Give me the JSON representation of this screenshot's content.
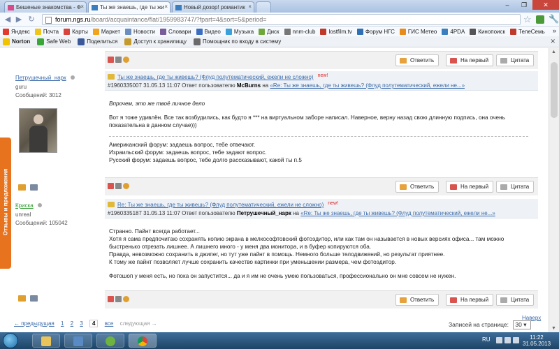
{
  "browser": {
    "tabs": [
      {
        "title": "Бешеные знакомства - Ф"
      },
      {
        "title": "Ты же знаешь, где ты жи"
      },
      {
        "title": "Новый дозор! романтик"
      }
    ],
    "url_host": "forum.ngs.ru",
    "url_path": "/board/acquaintance/flat/1959983747/?fpart=4&sort=5&period=",
    "bookmarks": [
      {
        "label": "Яндекс",
        "color": "#e23b2e"
      },
      {
        "label": "Почта",
        "color": "#f0c419"
      },
      {
        "label": "Карты",
        "color": "#d8433b"
      },
      {
        "label": "Маркет",
        "color": "#f3a21d"
      },
      {
        "label": "Новости",
        "color": "#6c8ebf"
      },
      {
        "label": "Словари",
        "color": "#7a5c9a"
      },
      {
        "label": "Видео",
        "color": "#3b6dc1"
      },
      {
        "label": "Музыка",
        "color": "#3aa0d9"
      },
      {
        "label": "Диск",
        "color": "#6fa83a"
      },
      {
        "label": "nnm-club",
        "color": "#777777"
      },
      {
        "label": "lostfilm.tv",
        "color": "#c0392b"
      },
      {
        "label": "Форум НГС",
        "color": "#2f6fb3"
      },
      {
        "label": "ГИС Метео",
        "color": "#e88b1a"
      },
      {
        "label": "4PDA",
        "color": "#3a7ebf"
      },
      {
        "label": "Кинопоиск",
        "color": "#555555"
      },
      {
        "label": "ТелеСемь",
        "color": "#c0392b"
      }
    ],
    "norton_items": [
      {
        "label": "Norton",
        "color": "#f2c200"
      },
      {
        "label": "Safe Web",
        "color": "#3aa63a"
      },
      {
        "label": "Поделиться",
        "color": "#3b5998"
      },
      {
        "label": "Доступ к хранилищу",
        "color": "#c49a2c"
      },
      {
        "label": "Помощник по входу в систему",
        "color": "#6b6b6b"
      }
    ]
  },
  "feedback_tab": "Отзывы и предложения",
  "actions": {
    "reply": "Ответить",
    "first": "На первый",
    "quote": "Цитата"
  },
  "posts": [
    {
      "author": "Петрушечный_нарк",
      "role": "guru",
      "count_label": "Сообщений: 3012",
      "title": "Ты же знаешь, где ты живешь? (Флуд полутематический, ежели не сложно)",
      "new_badge": "new!",
      "meta_prefix": "#1960335007 31.05.13 11:07  Ответ пользователю",
      "reply_to": "McBurns",
      "meta_on": "на",
      "reply_link": "«Re: Ты же знаешь, где ты живешь? (Флуд полутематический, ежели не...»",
      "body": [
        "Впрочем, это же твоё личное дело",
        "Вот я тоже удивлён. Все так возбудились, как будто я *** на виртуальном заборе написал. Наверное, верну назад свою длинную подпись, она очень показательна в данном случае)))",
        "Американский форум: задаешь вопрос, тебе отвечают.",
        "Израильский форум: задаешь вопрос, тебе задают вопрос.",
        "Русский форум: задаешь вопрос, тебе долго рассказывают, какой ты п.5"
      ]
    },
    {
      "author": "Криска",
      "role": "unreal",
      "count_label": "Сообщений: 105042",
      "title": "Re: Ты же знаешь, где ты живешь? (Флуд полутематический, ежели не сложно)",
      "new_badge": "new!",
      "meta_prefix": "#1960335187 31.05.13 11:07  Ответ пользователю",
      "reply_to": "Петрушечный_нарк",
      "meta_on": "на",
      "reply_link": "«Re: Ты же знаешь, где ты живешь? (Флуд полутематический, ежели не...»",
      "body": [
        "Странно. Пайнт всегда работает...",
        "Хотя я сама предпочитаю сохранять копию экрана в мелкософтовский фотоэдитор, или как там он называется в новых версиях офиса... там можно быстренько отрезать лишнее. А лишнего много - у меня два монитора, и в буфер копируются оба.",
        "Правда, невозможно сохранить в джипег, но тут уже пайнт в помощь. Немного больше телодвижений, но результат приятнее.",
        "К тому же пайнт позволяет лучше сохранить качество картинки при уменьшении размера, чем фотоэдитор.",
        "Фотошоп у меня есть, но пока он запустится... да и я им не очень умею пользоваться, профессионально он мне совсем не нужен."
      ]
    }
  ],
  "pagination": {
    "prev": "← предыдущая",
    "pages": [
      "1",
      "2",
      "3"
    ],
    "current": "4",
    "all": "все",
    "next": "следующая →",
    "per_page_label": "Записей на странице:",
    "per_page_value": "30",
    "to_top": "Наверх"
  },
  "taskbar": {
    "lang": "RU",
    "time": "11:22",
    "date": "31.05.2013"
  }
}
